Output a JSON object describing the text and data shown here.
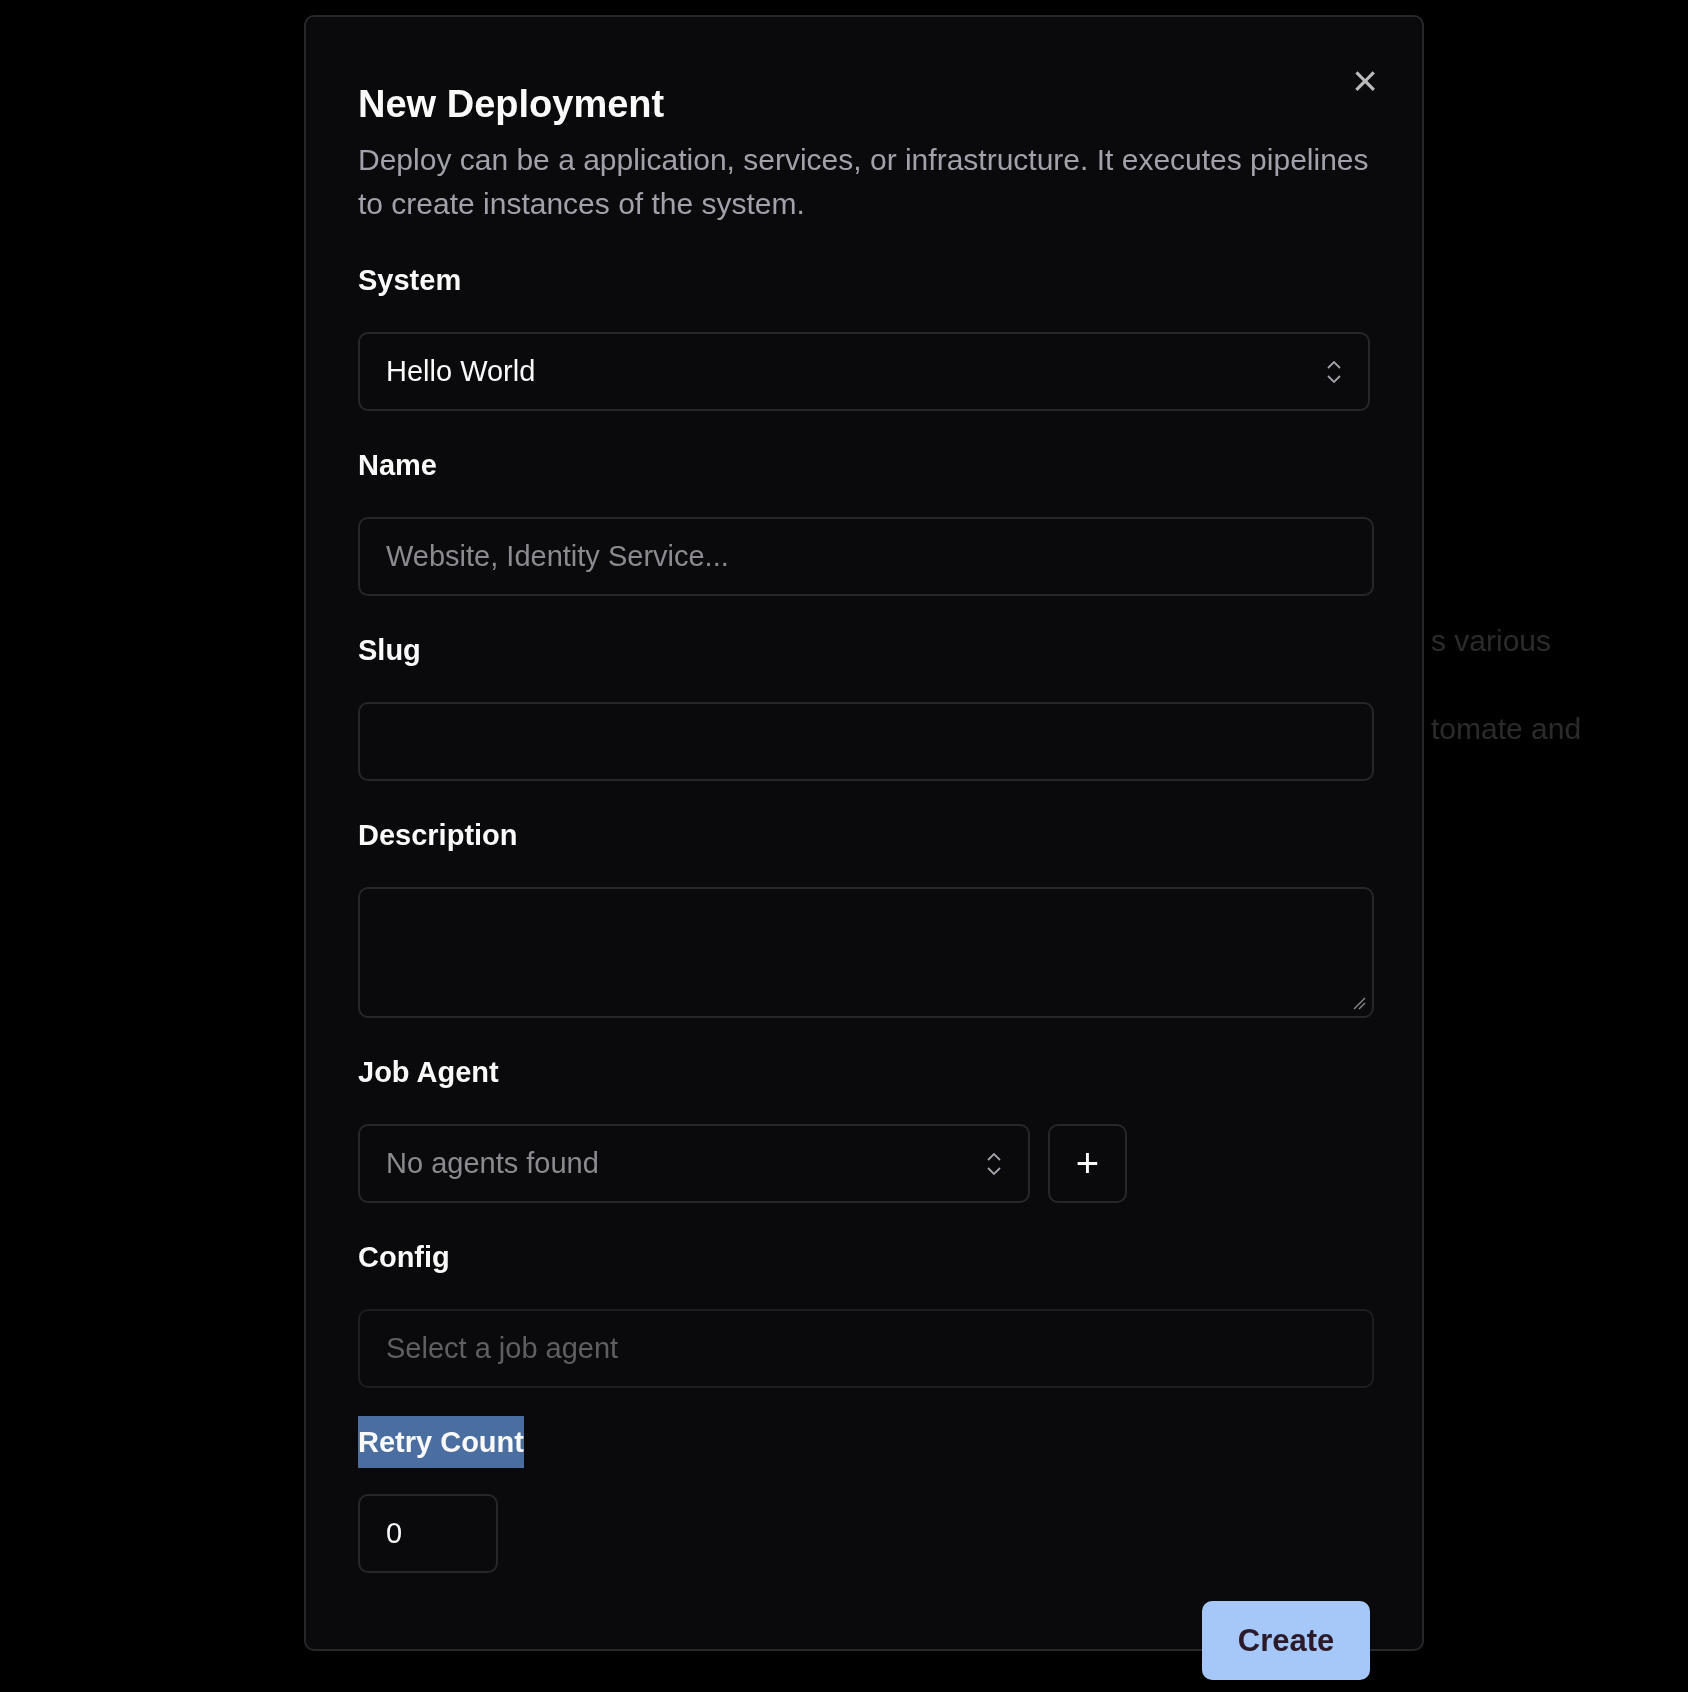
{
  "background_text": [
    "s various",
    "tomate and"
  ],
  "dialog": {
    "title": "New Deployment",
    "description": "Deploy can be a application, services, or infrastructure. It executes pipelines to create instances of the system.",
    "close": "×"
  },
  "fields": [
    {
      "kind": "select",
      "label": "System",
      "value": "Hello World",
      "disabled": false,
      "highlighted": false
    },
    {
      "kind": "text",
      "label": "Name",
      "placeholder": "Website, Identity Service...",
      "highlighted": false
    },
    {
      "kind": "text",
      "label": "Slug",
      "highlighted": false
    },
    {
      "kind": "textarea",
      "label": "Description",
      "highlighted": false
    },
    {
      "kind": "select",
      "label": "Job Agent",
      "value": "No agents found",
      "disabled": true,
      "add_button": "+",
      "highlighted": false
    },
    {
      "kind": "text",
      "label": "Config",
      "placeholder": "Select a job agent",
      "disabled": true,
      "highlighted": false
    },
    {
      "kind": "number",
      "label": "Retry Count",
      "value": "0",
      "highlighted": true
    }
  ],
  "submit": "Create"
}
